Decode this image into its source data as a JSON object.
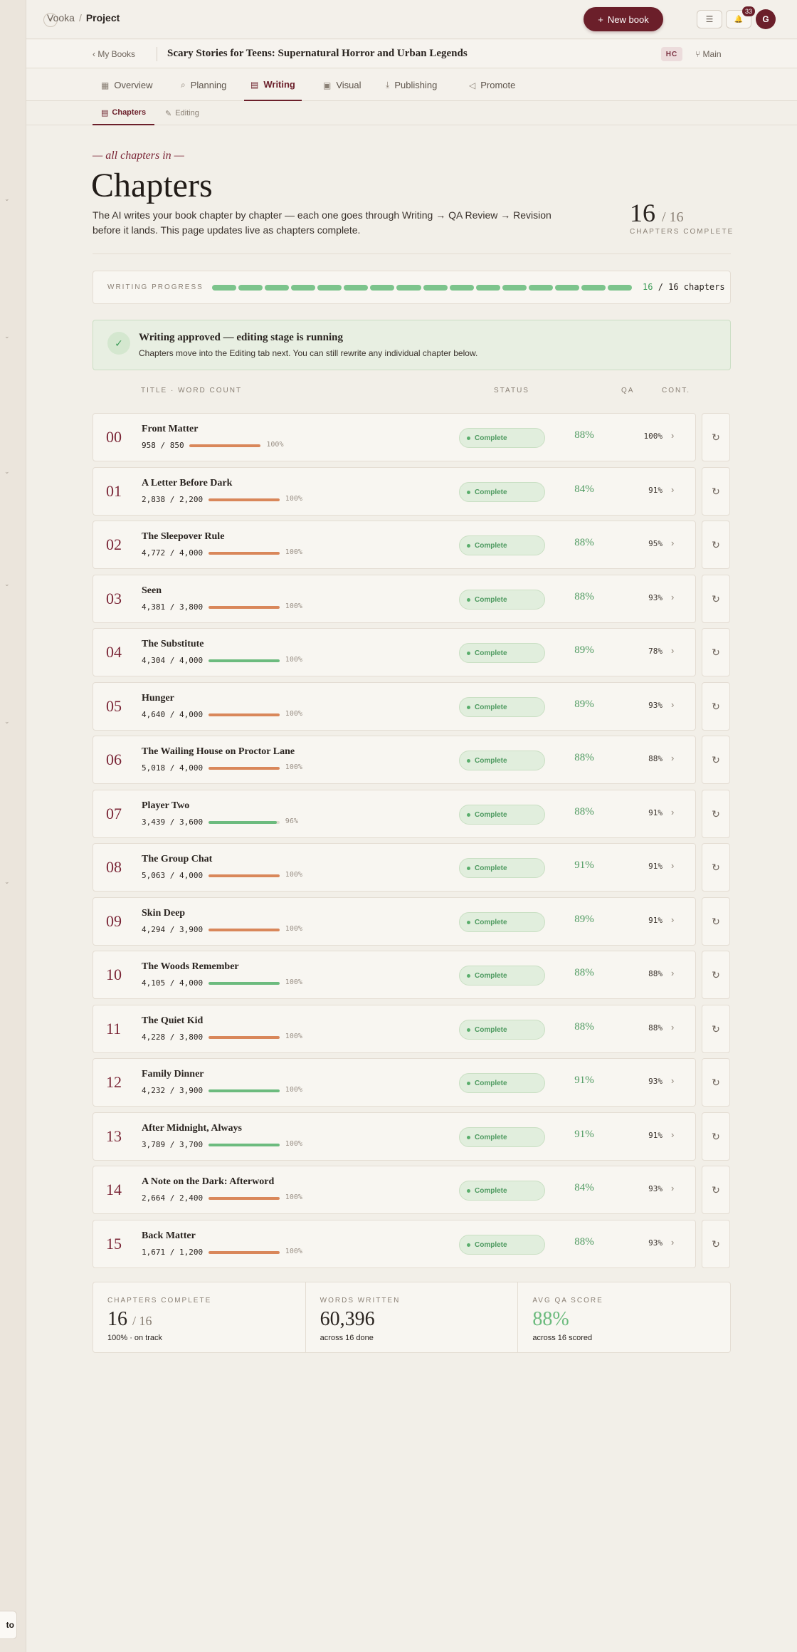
{
  "breadcrumb": {
    "root": "Vooka",
    "separator": "/",
    "current": "Project"
  },
  "header": {
    "new_book_icon": "+",
    "new_book_label": "New book",
    "list_icon": "☰",
    "bell_icon": "🔔",
    "notification_count": "33",
    "avatar_initial": "G"
  },
  "bookbar": {
    "back_icon": "‹",
    "my_books_label": "My Books",
    "book_title": "Scary Stories for Teens: Supernatural Horror and Urban Legends",
    "edition_badge": "HC",
    "branch_icon": "⑂",
    "branch_label": "Main"
  },
  "tabs": [
    {
      "label": "Overview",
      "icon": "▦"
    },
    {
      "label": "Planning",
      "icon": "⌕"
    },
    {
      "label": "Writing",
      "icon": "▤"
    },
    {
      "label": "Visual",
      "icon": "▣"
    },
    {
      "label": "Publishing",
      "icon": "⤓"
    },
    {
      "label": "Promote",
      "icon": "◁"
    }
  ],
  "subtabs": [
    {
      "label": "Chapters",
      "icon": "▤"
    },
    {
      "label": "Editing",
      "icon": "✎"
    }
  ],
  "heading": {
    "kicker": "— all chapters in —",
    "title": "Chapters",
    "description": "The AI writes your book chapter by chapter — each one goes through Writing → QA Review → Revision before it lands. This page updates live as chapters complete.",
    "complete_count": "16",
    "complete_total": "/ 16",
    "complete_label": "CHAPTERS COMPLETE"
  },
  "progress": {
    "label": "WRITING PROGRESS",
    "done": 16,
    "total": 16,
    "done_text": "16",
    "rest_text": "/ 16 chapters"
  },
  "banner": {
    "check_icon": "✓",
    "title": "Writing approved — editing stage is running",
    "subtitle": "Chapters move into the Editing tab next. You can still rewrite any individual chapter below."
  },
  "columns": {
    "title": "TITLE · WORD COUNT",
    "status": "STATUS",
    "qa": "QA",
    "cont": "CONT."
  },
  "chapters": [
    {
      "num": "00",
      "title": "Front Matter",
      "words": "958 / 850",
      "progress": 100,
      "pct": "100%",
      "bar_color": "#d9875a",
      "status": "Complete",
      "qa": "88%",
      "cont": "100%"
    },
    {
      "num": "01",
      "title": "A Letter Before Dark",
      "words": "2,838 / 2,200",
      "progress": 100,
      "pct": "100%",
      "bar_color": "#d9875a",
      "status": "Complete",
      "qa": "84%",
      "cont": "91%"
    },
    {
      "num": "02",
      "title": "The Sleepover Rule",
      "words": "4,772 / 4,000",
      "progress": 100,
      "pct": "100%",
      "bar_color": "#d9875a",
      "status": "Complete",
      "qa": "88%",
      "cont": "95%"
    },
    {
      "num": "03",
      "title": "Seen",
      "words": "4,381 / 3,800",
      "progress": 100,
      "pct": "100%",
      "bar_color": "#d9875a",
      "status": "Complete",
      "qa": "88%",
      "cont": "93%"
    },
    {
      "num": "04",
      "title": "The Substitute",
      "words": "4,304 / 4,000",
      "progress": 100,
      "pct": "100%",
      "bar_color": "#6cbb7e",
      "status": "Complete",
      "qa": "89%",
      "cont": "78%"
    },
    {
      "num": "05",
      "title": "Hunger",
      "words": "4,640 / 4,000",
      "progress": 100,
      "pct": "100%",
      "bar_color": "#d9875a",
      "status": "Complete",
      "qa": "89%",
      "cont": "93%"
    },
    {
      "num": "06",
      "title": "The Wailing House on Proctor Lane",
      "words": "5,018 / 4,000",
      "progress": 100,
      "pct": "100%",
      "bar_color": "#d9875a",
      "status": "Complete",
      "qa": "88%",
      "cont": "88%"
    },
    {
      "num": "07",
      "title": "Player Two",
      "words": "3,439 / 3,600",
      "progress": 96,
      "pct": "96%",
      "bar_color": "#6cbb7e",
      "status": "Complete",
      "qa": "88%",
      "cont": "91%"
    },
    {
      "num": "08",
      "title": "The Group Chat",
      "words": "5,063 / 4,000",
      "progress": 100,
      "pct": "100%",
      "bar_color": "#d9875a",
      "status": "Complete",
      "qa": "91%",
      "cont": "91%"
    },
    {
      "num": "09",
      "title": "Skin Deep",
      "words": "4,294 / 3,900",
      "progress": 100,
      "pct": "100%",
      "bar_color": "#d9875a",
      "status": "Complete",
      "qa": "89%",
      "cont": "91%"
    },
    {
      "num": "10",
      "title": "The Woods Remember",
      "words": "4,105 / 4,000",
      "progress": 100,
      "pct": "100%",
      "bar_color": "#6cbb7e",
      "status": "Complete",
      "qa": "88%",
      "cont": "88%"
    },
    {
      "num": "11",
      "title": "The Quiet Kid",
      "words": "4,228 / 3,800",
      "progress": 100,
      "pct": "100%",
      "bar_color": "#d9875a",
      "status": "Complete",
      "qa": "88%",
      "cont": "88%"
    },
    {
      "num": "12",
      "title": "Family Dinner",
      "words": "4,232 / 3,900",
      "progress": 100,
      "pct": "100%",
      "bar_color": "#6cbb7e",
      "status": "Complete",
      "qa": "91%",
      "cont": "93%"
    },
    {
      "num": "13",
      "title": "After Midnight, Always",
      "words": "3,789 / 3,700",
      "progress": 100,
      "pct": "100%",
      "bar_color": "#6cbb7e",
      "status": "Complete",
      "qa": "91%",
      "cont": "91%"
    },
    {
      "num": "14",
      "title": "A Note on the Dark: Afterword",
      "words": "2,664 / 2,400",
      "progress": 100,
      "pct": "100%",
      "bar_color": "#d9875a",
      "status": "Complete",
      "qa": "84%",
      "cont": "93%"
    },
    {
      "num": "15",
      "title": "Back Matter",
      "words": "1,671 / 1,200",
      "progress": 100,
      "pct": "100%",
      "bar_color": "#d9875a",
      "status": "Complete",
      "qa": "88%",
      "cont": "93%"
    }
  ],
  "row_icons": {
    "arrow": "›",
    "rewrite": "↻"
  },
  "summary": [
    {
      "label": "CHAPTERS COMPLETE",
      "value": "16",
      "of": "/ 16",
      "sub": "100% · on track"
    },
    {
      "label": "WORDS WRITTEN",
      "value": "60,396",
      "of": "",
      "sub": "across 16 done"
    },
    {
      "label": "AVG QA SCORE",
      "value": "88%",
      "of": "",
      "sub": "across 16 scored"
    }
  ],
  "rail": {
    "pill_text": "to"
  },
  "colors": {
    "accent": "#6b1f2a",
    "success": "#4e9a60",
    "bar_orange": "#d9875a",
    "bar_green": "#6cbb7e"
  }
}
